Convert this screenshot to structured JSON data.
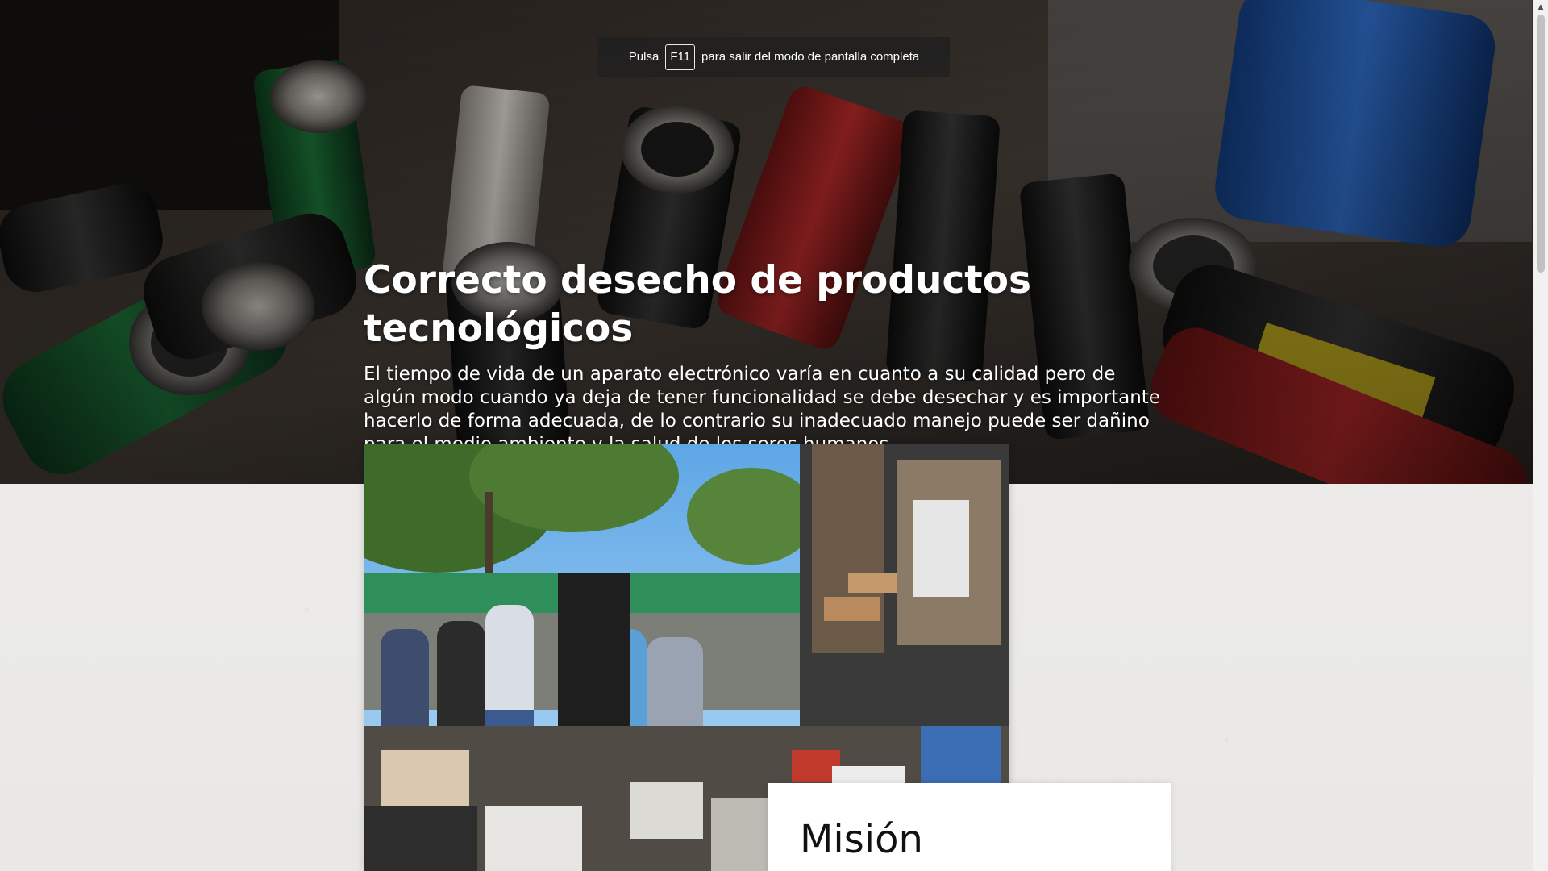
{
  "fullscreen_notice": {
    "prefix": "Pulsa",
    "key": "F11",
    "suffix": "para salir del modo de pantalla completa"
  },
  "hero": {
    "title": "Correcto desecho de productos tecnológicos",
    "text": "El tiempo de vida de un aparato electrónico varía en cuanto a su calidad pero de algún modo cuando ya deja de tener funcionalidad se debe desechar y es importante hacerlo de forma adecuada, de lo contrario su inadecuado manejo puede ser dañino para el medio ambiente y la salud de los seres humanos.",
    "image_icon": "batteries-photo"
  },
  "main_image": {
    "icon": "e-waste-collection-photo"
  },
  "mission": {
    "title": "Misión"
  },
  "colors": {
    "hero_text": "#ffffff",
    "page_background": "#ecebe9",
    "card_background": "#ffffff"
  }
}
